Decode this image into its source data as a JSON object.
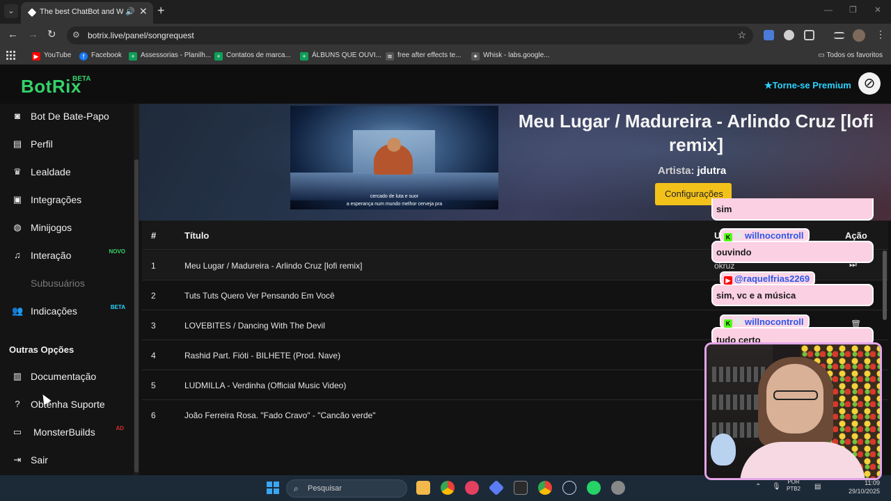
{
  "browser": {
    "tab_title": "The best ChatBot and Widg",
    "tab_audio_icon": "speaker-icon",
    "tab_close_icon": "close-icon",
    "new_tab_icon": "plus-icon",
    "url": "botrix.live/panel/songrequest",
    "bookmarks": [
      {
        "label": "YouTube",
        "icon": "youtube-icon",
        "color": "#ff0000"
      },
      {
        "label": "Facebook",
        "icon": "facebook-icon",
        "color": "#1877f2"
      },
      {
        "label": "Assessorias - Planilh...",
        "icon": "sheets-icon",
        "color": "#0f9d58"
      },
      {
        "label": "Contatos de marca...",
        "icon": "sheets-icon",
        "color": "#0f9d58"
      },
      {
        "label": "ÁLBUNS QUE OUVI...",
        "icon": "sheets-icon",
        "color": "#0f9d58"
      },
      {
        "label": "free after effects te...",
        "icon": "ae-icon",
        "color": "#9aa0a6"
      },
      {
        "label": "Whisk - labs.google...",
        "icon": "whisk-icon",
        "color": "#9aa0a6"
      }
    ],
    "all_bookmarks": "Todos os favoritos"
  },
  "app": {
    "brand": "BotRix",
    "brand_badge": "BETA",
    "premium_label": "Torne-se Premium",
    "accent": "#35d16a",
    "premium_color": "#2bd3ff"
  },
  "sidebar": {
    "items": [
      {
        "label": "Bot De Bate-Papo",
        "icon": "robot-icon"
      },
      {
        "label": "Perfil",
        "icon": "id-card-icon"
      },
      {
        "label": "Lealdade",
        "icon": "trophy-icon"
      },
      {
        "label": "Integrações",
        "icon": "integration-icon"
      },
      {
        "label": "Minijogos",
        "icon": "gamepad-icon"
      },
      {
        "label": "Interação",
        "icon": "music-note-icon",
        "badge": "NOVO"
      },
      {
        "label": "Subusuários",
        "icon": "",
        "disabled": true
      },
      {
        "label": "Indicações",
        "icon": "users-icon",
        "badge": "BETA"
      }
    ],
    "section_title": "Outras Opções",
    "other_items": [
      {
        "label": "Documentação",
        "icon": "book-icon"
      },
      {
        "label": "Obtenha Suporte",
        "icon": "question-icon"
      },
      {
        "label": "MonsterBuilds",
        "icon": "laptop-icon",
        "badge": "AD"
      },
      {
        "label": "Sair",
        "icon": "logout-icon"
      }
    ]
  },
  "now_playing": {
    "title": "Meu Lugar / Madureira - Arlindo Cruz [lofi remix]",
    "artist_label": "Artista:",
    "artist": "jdutra",
    "config_button": "Configurações",
    "subtitle_line1": "cercado de luta e suor",
    "subtitle_line2": "a esperança num mundo melhor cerveja pra"
  },
  "queue": {
    "headers": {
      "num": "#",
      "title": "Título",
      "user": "U",
      "action": "Ação"
    },
    "rows": [
      {
        "num": "1",
        "title": "Meu Lugar / Madureira - Arlindo Cruz [lofi remix]"
      },
      {
        "num": "2",
        "title": "Tuts Tuts Quero Ver Pensando Em Você"
      },
      {
        "num": "3",
        "title": "LOVEBITES / Dancing With The Devil"
      },
      {
        "num": "4",
        "title": "Rashid Part. Fióti - BILHETE (Prod. Nave)"
      },
      {
        "num": "5",
        "title": "LUDMILLA - Verdinha (Official Music Video)"
      },
      {
        "num": "6",
        "title": "João Ferreira Rosa, \"Fado Cravo\" - \"Canção verde\""
      }
    ],
    "peek_user": "okruz"
  },
  "chat_overlay": {
    "msg_top": "sim",
    "user1": "willnocontroll",
    "msg1": "ouvindo",
    "user2": "@raquelfrias2269",
    "msg2": "sim, vc e a música",
    "user3": "willnocontroll",
    "msg3": "tudo certo"
  },
  "taskbar": {
    "search_placeholder": "Pesquisar",
    "lang_line1": "POR",
    "lang_line2": "PTB2",
    "time": "11:09",
    "date": "29/10/2025"
  }
}
